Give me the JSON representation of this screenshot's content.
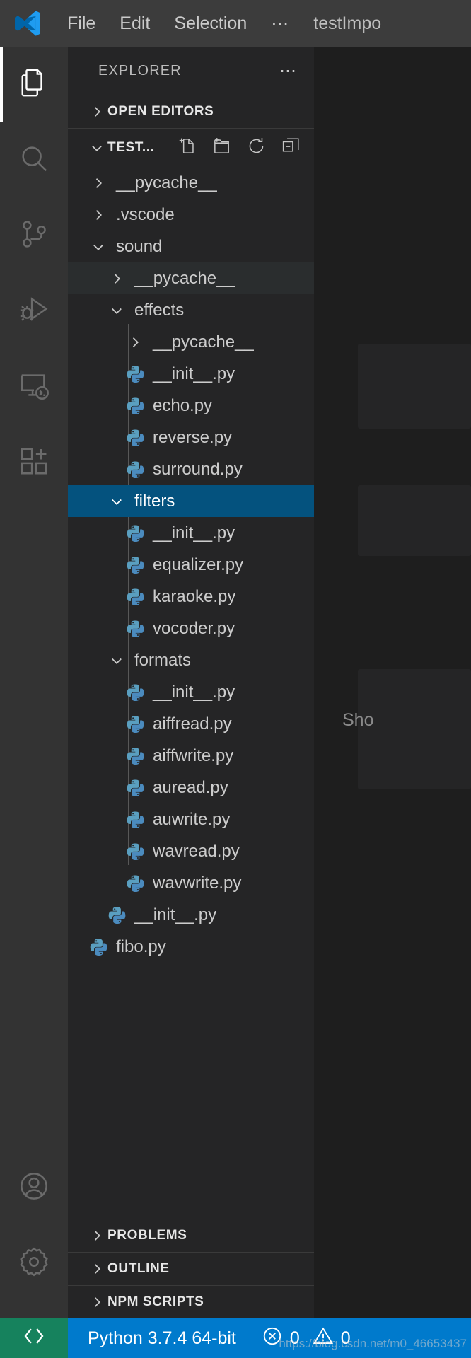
{
  "titlebar": {
    "logo_icon": "vscode-logo-icon",
    "menu": [
      "File",
      "Edit",
      "Selection"
    ],
    "overflow_label": "⋯",
    "window_title": "testImpo"
  },
  "activitybar": {
    "items": [
      {
        "name": "explorer",
        "icon": "files-icon",
        "active": true
      },
      {
        "name": "search",
        "icon": "search-icon",
        "active": false
      },
      {
        "name": "source-control",
        "icon": "source-control-icon",
        "active": false
      },
      {
        "name": "run-and-debug",
        "icon": "run-debug-icon",
        "active": false
      },
      {
        "name": "remote-explorer",
        "icon": "remote-explorer-icon",
        "active": false
      },
      {
        "name": "extensions",
        "icon": "extensions-icon",
        "active": false
      }
    ],
    "bottom_items": [
      {
        "name": "accounts",
        "icon": "account-icon"
      },
      {
        "name": "manage",
        "icon": "gear-icon"
      }
    ]
  },
  "sidebar": {
    "title": "EXPLORER",
    "more_actions": "⋯",
    "open_editors": {
      "label": "OPEN EDITORS",
      "expanded": false
    },
    "workspace": {
      "label": "TEST...",
      "expanded": true,
      "actions": [
        "new-file-icon",
        "new-folder-icon",
        "refresh-icon",
        "collapse-all-icon"
      ]
    },
    "tree": [
      {
        "label": "__pycache__",
        "depth": 1,
        "type": "folder",
        "expanded": false,
        "selected": false,
        "hovered": false
      },
      {
        "label": ".vscode",
        "depth": 1,
        "type": "folder",
        "expanded": false,
        "selected": false,
        "hovered": false
      },
      {
        "label": "sound",
        "depth": 1,
        "type": "folder",
        "expanded": true,
        "selected": false,
        "hovered": false
      },
      {
        "label": "__pycache__",
        "depth": 2,
        "type": "folder",
        "expanded": false,
        "selected": false,
        "hovered": true
      },
      {
        "label": "effects",
        "depth": 2,
        "type": "folder",
        "expanded": true,
        "selected": false,
        "hovered": false
      },
      {
        "label": "__pycache__",
        "depth": 3,
        "type": "folder",
        "expanded": false,
        "selected": false,
        "hovered": false
      },
      {
        "label": "__init__.py",
        "depth": 3,
        "type": "python",
        "expanded": null,
        "selected": false,
        "hovered": false
      },
      {
        "label": "echo.py",
        "depth": 3,
        "type": "python",
        "expanded": null,
        "selected": false,
        "hovered": false
      },
      {
        "label": "reverse.py",
        "depth": 3,
        "type": "python",
        "expanded": null,
        "selected": false,
        "hovered": false
      },
      {
        "label": "surround.py",
        "depth": 3,
        "type": "python",
        "expanded": null,
        "selected": false,
        "hovered": false
      },
      {
        "label": "filters",
        "depth": 2,
        "type": "folder",
        "expanded": true,
        "selected": true,
        "hovered": false
      },
      {
        "label": "__init__.py",
        "depth": 3,
        "type": "python",
        "expanded": null,
        "selected": false,
        "hovered": false
      },
      {
        "label": "equalizer.py",
        "depth": 3,
        "type": "python",
        "expanded": null,
        "selected": false,
        "hovered": false
      },
      {
        "label": "karaoke.py",
        "depth": 3,
        "type": "python",
        "expanded": null,
        "selected": false,
        "hovered": false
      },
      {
        "label": "vocoder.py",
        "depth": 3,
        "type": "python",
        "expanded": null,
        "selected": false,
        "hovered": false
      },
      {
        "label": "formats",
        "depth": 2,
        "type": "folder",
        "expanded": true,
        "selected": false,
        "hovered": false
      },
      {
        "label": "__init__.py",
        "depth": 3,
        "type": "python",
        "expanded": null,
        "selected": false,
        "hovered": false
      },
      {
        "label": "aiffread.py",
        "depth": 3,
        "type": "python",
        "expanded": null,
        "selected": false,
        "hovered": false
      },
      {
        "label": "aiffwrite.py",
        "depth": 3,
        "type": "python",
        "expanded": null,
        "selected": false,
        "hovered": false
      },
      {
        "label": "auread.py",
        "depth": 3,
        "type": "python",
        "expanded": null,
        "selected": false,
        "hovered": false
      },
      {
        "label": "auwrite.py",
        "depth": 3,
        "type": "python",
        "expanded": null,
        "selected": false,
        "hovered": false
      },
      {
        "label": "wavread.py",
        "depth": 3,
        "type": "python",
        "expanded": null,
        "selected": false,
        "hovered": false
      },
      {
        "label": "wavwrite.py",
        "depth": 3,
        "type": "python",
        "expanded": null,
        "selected": false,
        "hovered": false
      },
      {
        "label": "__init__.py",
        "depth": 2,
        "type": "python",
        "expanded": null,
        "selected": false,
        "hovered": false
      },
      {
        "label": "fibo.py",
        "depth": 1,
        "type": "python",
        "expanded": null,
        "selected": false,
        "hovered": false
      }
    ],
    "panels": [
      {
        "label": "PROBLEMS",
        "expanded": false
      },
      {
        "label": "OUTLINE",
        "expanded": false
      },
      {
        "label": "NPM SCRIPTS",
        "expanded": false
      }
    ]
  },
  "editor": {
    "suggestion_text": "Sho"
  },
  "statusbar": {
    "remote_icon": "remote-indicator-icon",
    "python_version": "Python 3.7.4 64-bit",
    "errors_icon": "error-circle-icon",
    "errors_count": "0",
    "warnings_icon": "warning-triangle-icon",
    "warnings_count": "0"
  },
  "watermark": "https://blog.csdn.net/m0_46653437",
  "colors": {
    "titlebar_bg": "#3C3C3C",
    "activitybar_bg": "#333333",
    "sidebar_bg": "#252526",
    "editor_bg": "#1E1E1E",
    "selection_bg": "#04527E",
    "hover_bg": "#2A2D2E",
    "statusbar_bg": "#007ACC",
    "remote_bg": "#16825D",
    "python_icon": "#4B8BBE",
    "text": "#CCCCCC"
  }
}
